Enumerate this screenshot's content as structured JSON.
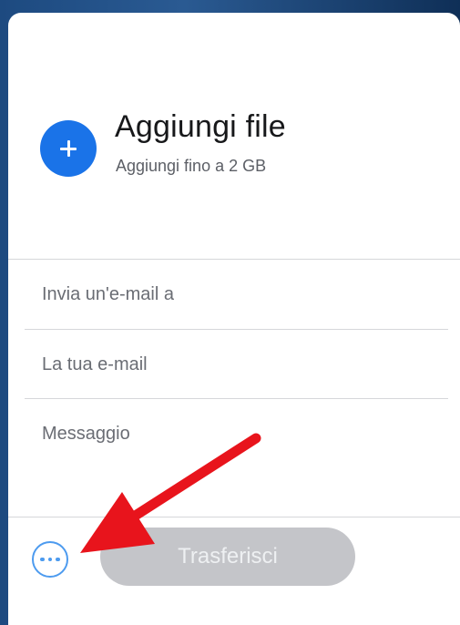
{
  "upload": {
    "title": "Aggiungi file",
    "subtitle": "Aggiungi fino a 2 GB",
    "add_icon": "plus-icon"
  },
  "form": {
    "recipient_placeholder": "Invia un'e-mail a",
    "sender_placeholder": "La tua e-mail",
    "message_placeholder": "Messaggio"
  },
  "actions": {
    "more_icon": "more-options-icon",
    "transfer_label": "Trasferisci"
  },
  "colors": {
    "accent": "#1a73e8",
    "more_icon": "#4d9bef",
    "transfer_disabled": "#c4c5c9",
    "annotation_arrow": "#e8141c"
  }
}
